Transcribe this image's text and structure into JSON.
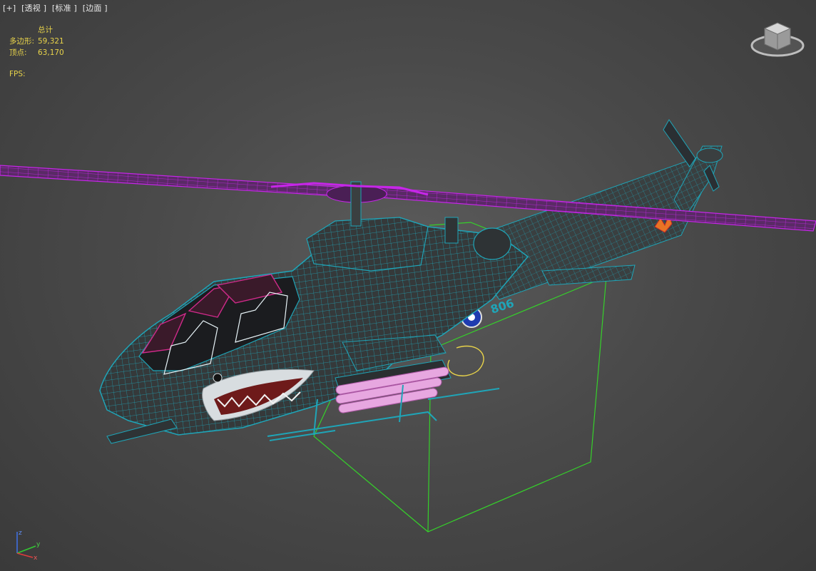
{
  "viewport": {
    "labels": [
      "[+]",
      "[透视 ]",
      "[标准 ]",
      "[边面 ]"
    ]
  },
  "stats": {
    "header": "总计",
    "polygons_label": "多边形:",
    "polygons_value": "59,321",
    "vertices_label": "顶点:",
    "vertices_value": "63,170",
    "fps_label": "FPS:"
  },
  "model": {
    "tail_number": "806",
    "wire_color": "#1fa5b8",
    "rotor_color": "#b41fd6",
    "bbox_color": "#35d12a"
  },
  "axis": {
    "z": "z",
    "y": "y",
    "x": "x"
  },
  "icons": [
    "viewcube-icon",
    "axis-tripod-icon"
  ]
}
